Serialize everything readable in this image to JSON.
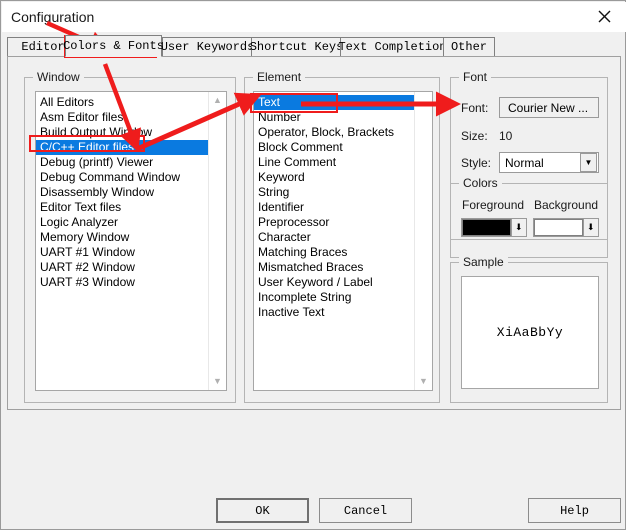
{
  "window": {
    "title": "Configuration",
    "close_icon": "close-icon"
  },
  "tabs": [
    {
      "label": "Editor",
      "selected": false
    },
    {
      "label": "Colors & Fonts",
      "selected": true
    },
    {
      "label": "User Keywords",
      "selected": false
    },
    {
      "label": "Shortcut Keys",
      "selected": false
    },
    {
      "label": "Text Completion",
      "selected": false
    },
    {
      "label": "Other",
      "selected": false
    }
  ],
  "window_group": {
    "title": "Window",
    "items": [
      "All Editors",
      "Asm Editor files",
      "Build Output Window",
      "C/C++ Editor files",
      "Debug (printf) Viewer",
      "Debug Command Window",
      "Disassembly Window",
      "Editor Text files",
      "Logic Analyzer",
      "Memory Window",
      "UART #1 Window",
      "UART #2 Window",
      "UART #3 Window"
    ],
    "selected_index": 3,
    "scroll_up_icon": "chevron-up-icon",
    "scroll_down_icon": "chevron-down-icon"
  },
  "element_group": {
    "title": "Element",
    "items": [
      "Text",
      "Number",
      "Operator, Block, Brackets",
      "Block Comment",
      "Line Comment",
      "Keyword",
      "String",
      "Identifier",
      "Preprocessor",
      "Character",
      "Matching Braces",
      "Mismatched Braces",
      "User Keyword / Label",
      "Incomplete String",
      "Inactive Text"
    ],
    "selected_index": 0,
    "scroll_down_icon": "chevron-down-icon"
  },
  "font_group": {
    "title": "Font",
    "font_label": "Font:",
    "font_value": "Courier New ...",
    "size_label": "Size:",
    "size_value": "10",
    "style_label": "Style:",
    "style_value": "Normal",
    "style_arrow_icon": "chevron-down-icon"
  },
  "colors_group": {
    "title": "Colors",
    "foreground_label": "Foreground",
    "background_label": "Background",
    "foreground_color": "#000000",
    "background_color": "#ffffff",
    "dropdown_icon": "color-dropdown-icon"
  },
  "sample_group": {
    "title": "Sample",
    "text": "XiAaBbYy"
  },
  "buttons": {
    "ok": "OK",
    "cancel": "Cancel",
    "help": "Help"
  },
  "annotations": {
    "accent_color": "#ef1c1c",
    "arrow_count": 3,
    "highlight_boxes": [
      "colors-fonts-tab",
      "c-cpp-editor-files-row",
      "text-element-row"
    ]
  }
}
